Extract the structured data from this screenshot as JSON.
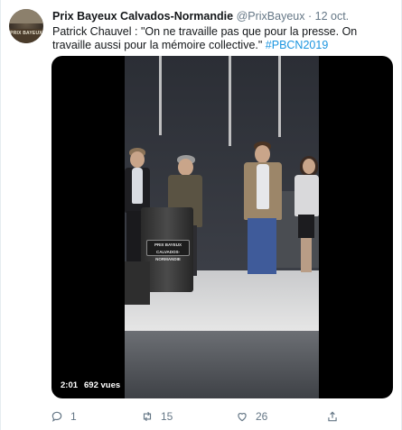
{
  "account": {
    "name": "Prix Bayeux Calvados-Normandie",
    "handle": "@PrixBayeux",
    "separator": "·",
    "date": "12 oct.",
    "avatar_icon": "prix-bayeux-logo-avatar",
    "avatar_text": "PRIX BAYEUX"
  },
  "tweet": {
    "text": "Patrick Chauvel : \"On ne travaille pas que pour la presse. On travaille aussi pour la mémoire collective.\" ",
    "hashtag": "#PBCN2019",
    "hashtag_color": "#1b95e0"
  },
  "video": {
    "duration": "2:01",
    "views": "692 vues",
    "podium_text": "PRIX BAYEUX CALVADOS-NORMANDIE"
  },
  "actions": {
    "reply_icon": "reply-icon",
    "reply_count": "1",
    "retweet_icon": "retweet-icon",
    "retweet_count": "15",
    "like_icon": "heart-icon",
    "like_count": "26",
    "share_icon": "share-icon"
  },
  "colors": {
    "text_primary": "#14171a",
    "text_secondary": "#657786",
    "link": "#1b95e0"
  }
}
